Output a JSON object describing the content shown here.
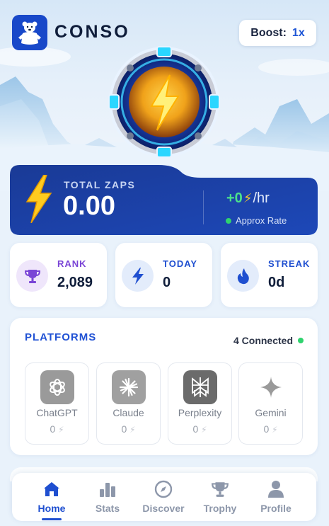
{
  "header": {
    "app_name": "CONSO",
    "logo_icon": "polar-bear-icon",
    "boost_label": "Boost:",
    "boost_value": "1x"
  },
  "hero": {
    "icon": "lightning-coin-icon"
  },
  "total_zaps": {
    "label": "TOTAL ZAPS",
    "value": "0.00",
    "rate_value": "+0",
    "rate_unit": "/hr",
    "rate_icon": "lightning-icon",
    "rate_caption": "Approx Rate"
  },
  "stats": [
    {
      "label": "RANK",
      "value": "2,089",
      "icon": "trophy-icon",
      "color": "#7a45d6"
    },
    {
      "label": "TODAY",
      "value": "0",
      "icon": "lightning-icon",
      "color": "#1f4fd0"
    },
    {
      "label": "STREAK",
      "value": "0d",
      "icon": "flame-icon",
      "color": "#1f4fd0"
    }
  ],
  "platforms": {
    "title": "PLATFORMS",
    "connected": "4 Connected",
    "items": [
      {
        "name": "ChatGPT",
        "count": "0",
        "icon": "chatgpt-icon"
      },
      {
        "name": "Claude",
        "count": "0",
        "icon": "claude-icon"
      },
      {
        "name": "Perplexity",
        "count": "0",
        "icon": "perplexity-icon"
      },
      {
        "name": "Gemini",
        "count": "0",
        "icon": "gemini-icon"
      }
    ]
  },
  "nav": {
    "items": [
      {
        "label": "Home",
        "icon": "home-icon",
        "active": true
      },
      {
        "label": "Stats",
        "icon": "bar-chart-icon"
      },
      {
        "label": "Discover",
        "icon": "compass-icon"
      },
      {
        "label": "Trophy",
        "icon": "trophy-icon"
      },
      {
        "label": "Profile",
        "icon": "user-icon"
      }
    ]
  },
  "colors": {
    "accent": "#1f4fd0",
    "card_dark": "#1a3e9a",
    "rate_green": "#4ce18b",
    "connected_dot": "#2fd36e"
  }
}
